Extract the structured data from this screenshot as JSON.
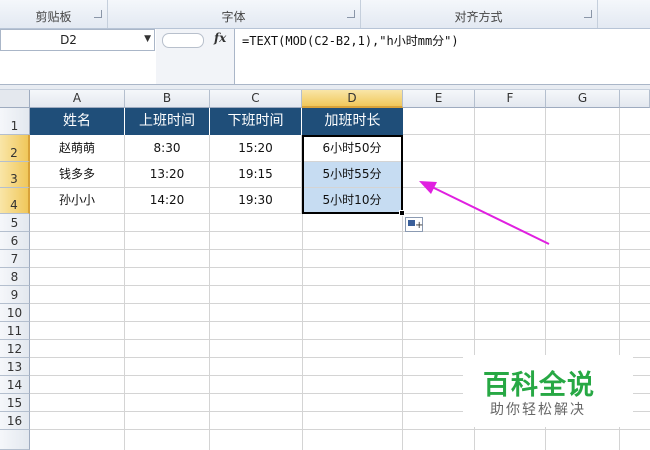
{
  "ribbon": {
    "groups": [
      "剪贴板",
      "字体",
      "对齐方式"
    ]
  },
  "formula_bar": {
    "name_box": "D2",
    "fx_label": "fx",
    "formula": "=TEXT(MOD(C2-B2,1),\"h小时mm分\")"
  },
  "columns": [
    "A",
    "B",
    "C",
    "D",
    "E",
    "F",
    "G"
  ],
  "rows": [
    "1",
    "2",
    "3",
    "4",
    "5",
    "6",
    "7",
    "8",
    "9",
    "10",
    "11",
    "12",
    "13",
    "14",
    "15",
    "16"
  ],
  "table": {
    "headers": [
      "姓名",
      "上班时间",
      "下班时间",
      "加班时长"
    ],
    "rows": [
      [
        "赵萌萌",
        "8:30",
        "15:20",
        "6小时50分"
      ],
      [
        "钱多多",
        "13:20",
        "19:15",
        "5小时55分"
      ],
      [
        "孙小小",
        "14:20",
        "19:30",
        "5小时10分"
      ]
    ]
  },
  "annotation_arrow_color": "#e020e0",
  "header_fill_color": "#1f4e79",
  "selection_fill_color": "#c6dcf2",
  "watermark": {
    "title": "百科全说",
    "subtitle": "助你轻松解决",
    "color": "#27a844"
  }
}
